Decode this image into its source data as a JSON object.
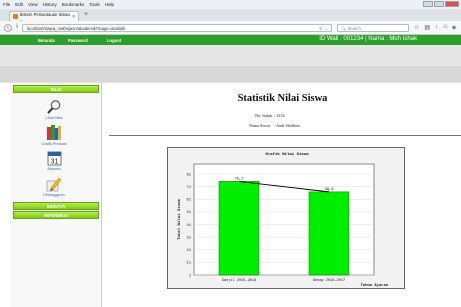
{
  "browser": {
    "menu_items": [
      "File",
      "Edit",
      "View",
      "History",
      "Bookmarks",
      "Tools",
      "Help"
    ],
    "tab_title": "Sistem Pemantauan Siswa ...",
    "tab_close": "×",
    "new_tab": "+",
    "url": "localhost/siswa_mathejasn/akademik/?page=statistik",
    "search_placeholder": "Search",
    "colors": {
      "window_close": "#d9534f",
      "tab_favicon": "#e87b22"
    }
  },
  "topnav": {
    "items": [
      "Beranda",
      "Password",
      "Logout"
    ],
    "welcome": "ID Wali : 001234 | Nama : Moh Ishak",
    "color": "#2c9e2c"
  },
  "sidebar": {
    "nilai_header": "NILAI",
    "items": [
      {
        "label": "Lihat Nilai",
        "icon": "search-icon"
      },
      {
        "label": "Grafik Prestasi",
        "icon": "books-icon"
      },
      {
        "label": "Absensi",
        "icon": "calendar-icon"
      },
      {
        "label": "Pelanggaran",
        "icon": "pencil-icon"
      }
    ],
    "biodata_header": "BIODATA",
    "informasi_header": "INFORMASI",
    "header_color": "#7fcb19"
  },
  "main": {
    "title": "Statistik Nilai Siswa",
    "no_induk_label": "No. Induk",
    "no_induk_value": ": 1234",
    "nama_label": "Nama Siswa",
    "nama_value": ": Andi Sholihin"
  },
  "chart_data": {
    "type": "bar",
    "title": "Grafik Nilai Siswa",
    "categories": [
      "Ganjil 2015-2016",
      "Genap 2016-2017"
    ],
    "values": [
      75.2,
      66.9
    ],
    "value_labels": [
      "75,2",
      "66,9"
    ],
    "overlay_line": true,
    "ylabel": "Total Nilai Siswa",
    "xlabel": "Tahun Ajaran",
    "yticks": [
      1,
      11,
      21,
      31,
      41,
      51,
      61,
      71,
      81
    ],
    "ylim": [
      1,
      89
    ],
    "bar_color": "#00ee00",
    "grid": true
  }
}
